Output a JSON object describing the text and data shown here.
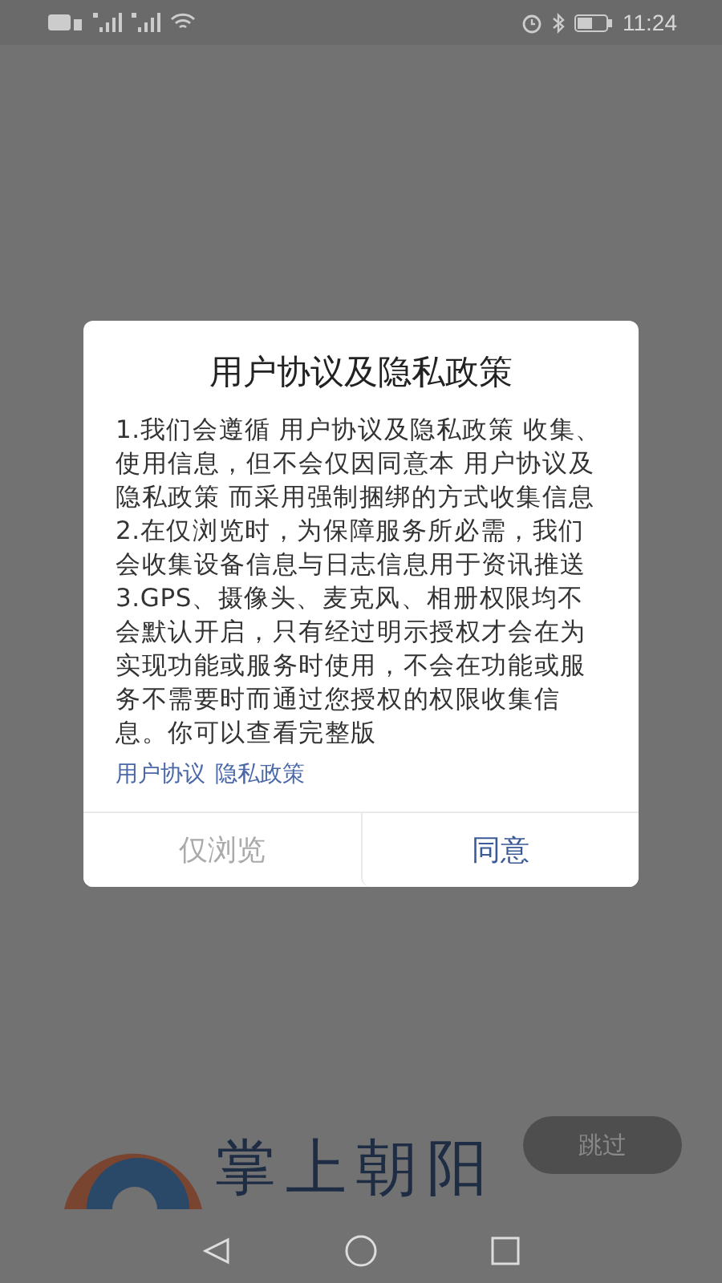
{
  "status_bar": {
    "time": "11:24"
  },
  "dialog": {
    "title": "用户协议及隐私政策",
    "paragraphs": [
      "1.我们会遵循 用户协议及隐私政策 收集、使用信息，但不会仅因同意本 用户协议及隐私政策 而采用强制捆绑的方式收集信息",
      "2.在仅浏览时，为保障服务所必需，我们会收集设备信息与日志信息用于资讯推送",
      "3.GPS、摄像头、麦克风、相册权限均不会默认开启，只有经过明示授权才会在为实现功能或服务时使用，不会在功能或服务不需要时而通过您授权的权限收集信息。你可以查看完整版"
    ],
    "links": [
      "用户协议",
      "隐私政策"
    ],
    "buttons": [
      {
        "label": "仅浏览",
        "kind": "secondary"
      },
      {
        "label": "同意",
        "kind": "primary"
      }
    ]
  },
  "splash": {
    "logo_text": "掌上朝阳",
    "skip": "跳过"
  }
}
